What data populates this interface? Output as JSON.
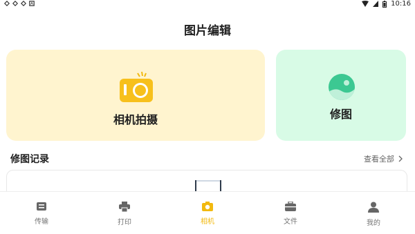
{
  "status": {
    "time": "10:16"
  },
  "page_title": "图片编辑",
  "cards": {
    "camera_label": "相机拍摄",
    "edit_label": "修图"
  },
  "records": {
    "section_title": "修图记录",
    "view_all": "查看全部"
  },
  "tabs": [
    {
      "label": "传输",
      "icon": "transfer-icon",
      "active": false
    },
    {
      "label": "打印",
      "icon": "printer-icon",
      "active": false
    },
    {
      "label": "相机",
      "icon": "camera-icon",
      "active": true
    },
    {
      "label": "文件",
      "icon": "briefcase-icon",
      "active": false
    },
    {
      "label": "我的",
      "icon": "user-icon",
      "active": false
    }
  ],
  "colors": {
    "accent": "#f2b90f",
    "camera_card_bg": "#fff4cf",
    "edit_card_bg": "#d8fbe6",
    "edit_icon": "#3cc892",
    "inactive_tab": "#777777"
  }
}
